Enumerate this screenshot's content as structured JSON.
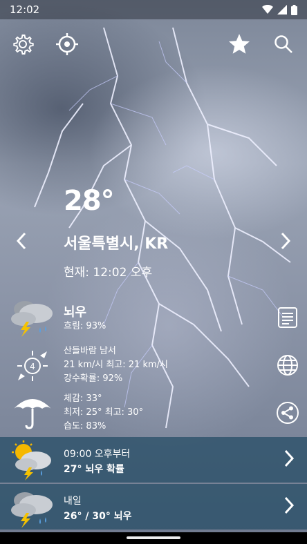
{
  "status": {
    "time": "12:02"
  },
  "header": {
    "settings_icon": "gear-icon",
    "location_icon": "crosshair-location-icon",
    "favorite_icon": "star-icon",
    "search_icon": "search-icon"
  },
  "current": {
    "temperature": "28°",
    "city": "서울특별시, KR",
    "time_label": "현재: 12:02 오후",
    "condition": "뇌우",
    "cloud": "흐림: 93%",
    "wind_dir": "산들바람 남서",
    "wind_speed": "21 km/시 최고: 21 km/시",
    "precip": "강수확률: 92%",
    "feels": "체감: 33°",
    "minmax": "최저: 25° 최고: 30°",
    "humidity": "습도: 83%",
    "wind_badge": "4"
  },
  "forecast": [
    {
      "line1": "09:00 오후부터",
      "line2": "27° 뇌우 확률"
    },
    {
      "line1": "내일",
      "line2": "26° / 30° 뇌우"
    }
  ],
  "colors": {
    "panel": "#234b64",
    "bolt": "#e8ecff"
  }
}
